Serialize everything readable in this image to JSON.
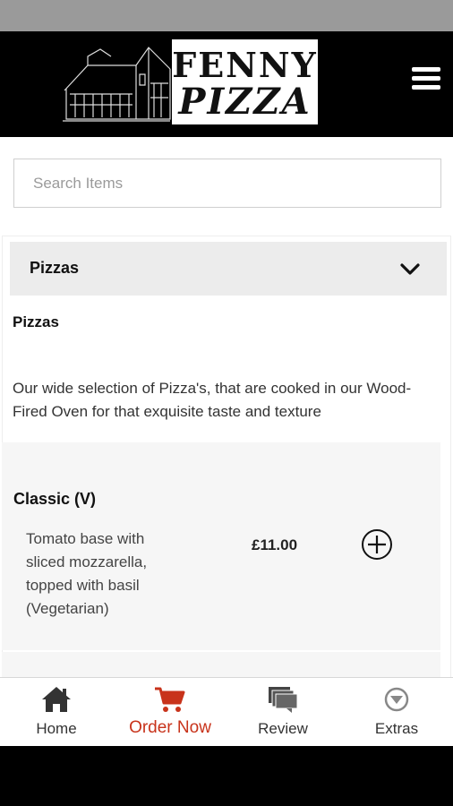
{
  "brand": {
    "line1": "FENNY",
    "line2": "PIZZA"
  },
  "search": {
    "placeholder": "Search Items",
    "value": ""
  },
  "category": {
    "title": "Pizzas",
    "section_title": "Pizzas",
    "description": "Our wide selection of Pizza's, that are cooked in our Wood-Fired Oven for that exquisite taste and texture"
  },
  "items": [
    {
      "name": "Classic (V)",
      "description": "Tomato base with sliced mozzarella, topped with basil (Vegetarian)",
      "price": "£11.00"
    }
  ],
  "nav": {
    "home": "Home",
    "order": "Order Now",
    "review": "Review",
    "extras": "Extras"
  },
  "colors": {
    "accent": "#c8331b",
    "header_bg": "#000000",
    "category_bg": "#ececec"
  },
  "icons": [
    "house-logo",
    "menu-icon",
    "chevron-down-icon",
    "add-circle-icon",
    "home-icon",
    "cart-icon",
    "review-icon",
    "extras-icon"
  ]
}
